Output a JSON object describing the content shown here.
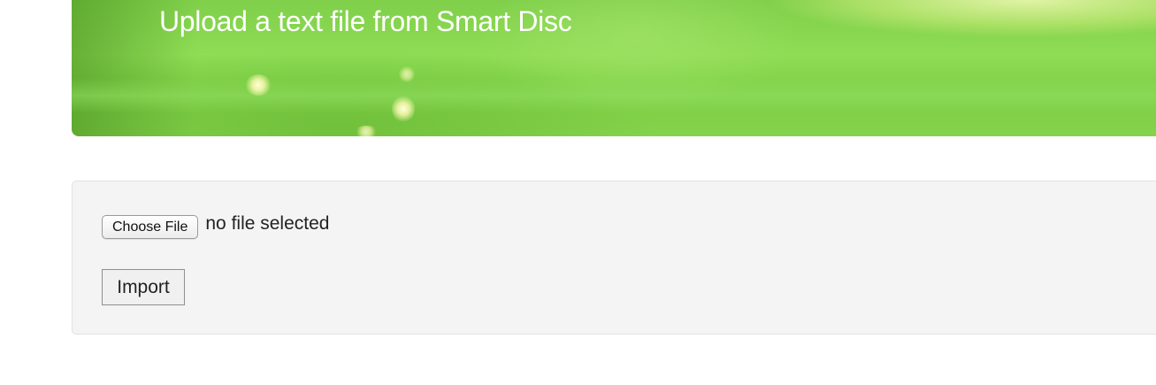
{
  "hero": {
    "title": "Upload a text file from Smart Disc"
  },
  "upload_form": {
    "choose_file_label": "Choose File",
    "file_status": "no file selected",
    "import_label": "Import"
  },
  "colors": {
    "hero_green": "#86d24c",
    "panel_background": "#f4f4f4",
    "panel_border": "#e2e2e2"
  }
}
